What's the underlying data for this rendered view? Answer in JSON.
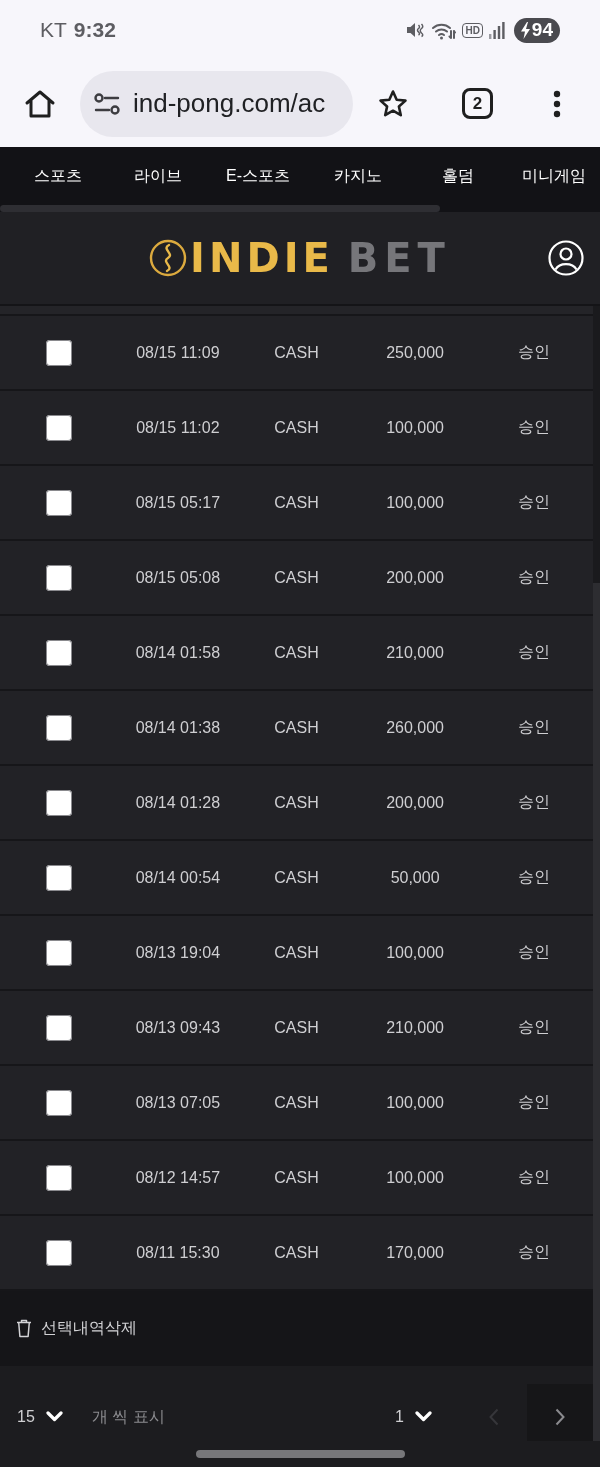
{
  "status_bar": {
    "carrier": "KT",
    "time": "9:32",
    "hd_label": "HD",
    "battery": "94"
  },
  "browser": {
    "url": "ind-pong.com/ac",
    "tab_count": "2"
  },
  "nav": {
    "items": [
      {
        "label": "스포츠",
        "selected": false
      },
      {
        "label": "라이브",
        "selected": false
      },
      {
        "label": "E-스포츠",
        "selected": false
      },
      {
        "label": "카지노",
        "selected": false
      },
      {
        "label": "홀덤",
        "selected": false
      },
      {
        "label": "미니게임",
        "selected": false
      }
    ]
  },
  "header": {
    "logo_primary": "INDIE",
    "logo_secondary": "BET"
  },
  "table": {
    "rows": [
      {
        "checked": false,
        "date": "08/15 11:09",
        "type": "CASH",
        "amount": "250,000",
        "status": "승인"
      },
      {
        "checked": false,
        "date": "08/15 11:02",
        "type": "CASH",
        "amount": "100,000",
        "status": "승인"
      },
      {
        "checked": false,
        "date": "08/15 05:17",
        "type": "CASH",
        "amount": "100,000",
        "status": "승인"
      },
      {
        "checked": false,
        "date": "08/15 05:08",
        "type": "CASH",
        "amount": "200,000",
        "status": "승인"
      },
      {
        "checked": false,
        "date": "08/14 01:58",
        "type": "CASH",
        "amount": "210,000",
        "status": "승인"
      },
      {
        "checked": false,
        "date": "08/14 01:38",
        "type": "CASH",
        "amount": "260,000",
        "status": "승인"
      },
      {
        "checked": false,
        "date": "08/14 01:28",
        "type": "CASH",
        "amount": "200,000",
        "status": "승인"
      },
      {
        "checked": false,
        "date": "08/14 00:54",
        "type": "CASH",
        "amount": "50,000",
        "status": "승인"
      },
      {
        "checked": false,
        "date": "08/13 19:04",
        "type": "CASH",
        "amount": "100,000",
        "status": "승인"
      },
      {
        "checked": false,
        "date": "08/13 09:43",
        "type": "CASH",
        "amount": "210,000",
        "status": "승인"
      },
      {
        "checked": false,
        "date": "08/13 07:05",
        "type": "CASH",
        "amount": "100,000",
        "status": "승인"
      },
      {
        "checked": false,
        "date": "08/12 14:57",
        "type": "CASH",
        "amount": "100,000",
        "status": "승인"
      },
      {
        "checked": false,
        "date": "08/11 15:30",
        "type": "CASH",
        "amount": "170,000",
        "status": "승인"
      }
    ]
  },
  "actions": {
    "delete_label": "선택내역삭제"
  },
  "pagination": {
    "per_page": "15",
    "per_page_label": "개 씩 표시",
    "page": "1",
    "prev": {
      "disabled": true
    },
    "next": {
      "disabled": false
    }
  }
}
